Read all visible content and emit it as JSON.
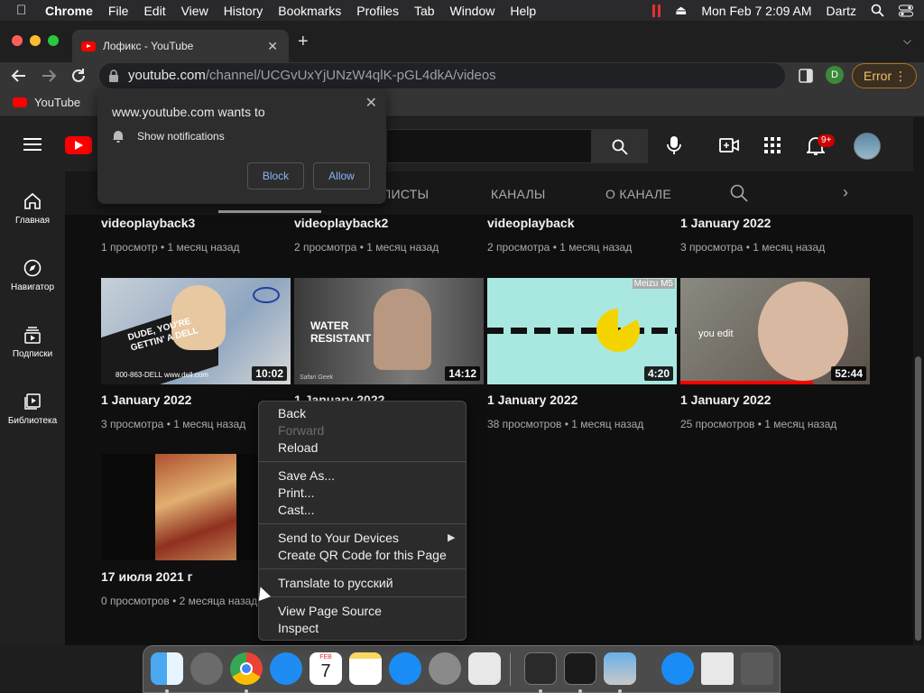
{
  "menubar": {
    "app": "Chrome",
    "items": [
      "File",
      "Edit",
      "View",
      "History",
      "Bookmarks",
      "Profiles",
      "Tab",
      "Window",
      "Help"
    ],
    "datetime": "Mon Feb 7  2:09 AM",
    "user": "Dartz"
  },
  "tab": {
    "title": "Лофикс - YouTube",
    "close": "✕",
    "new_tab": "+"
  },
  "toolbar": {
    "url_host": "youtube.com",
    "url_path": "/channel/UCGvUxYjUNzW4qlK-pGL4dkA/videos",
    "profile_initial": "D",
    "error_label": "Error"
  },
  "bookmarks": {
    "youtube_label": "YouTube"
  },
  "notification_popup": {
    "title": "www.youtube.com wants to",
    "permission": "Show notifications",
    "block_label": "Block",
    "allow_label": "Allow",
    "close": "✕"
  },
  "yt_header": {
    "notif_count": "9+"
  },
  "sidebar": {
    "items": [
      {
        "label": "Главная"
      },
      {
        "label": "Навигатор"
      },
      {
        "label": "Подписки"
      },
      {
        "label": "Библиотека"
      }
    ]
  },
  "channel_tabs": {
    "playlists": "ЛИСТЫ",
    "channels": "КАНАЛЫ",
    "about": "О КАНАЛЕ"
  },
  "videos": {
    "row1": [
      {
        "title": "videoplayback3",
        "meta": "1 просмотр • 1 месяц назад"
      },
      {
        "title": "videoplayback2",
        "meta": "2 просмотра • 1 месяц назад"
      },
      {
        "title": "videoplayback",
        "meta": "2 просмотра • 1 месяц назад"
      },
      {
        "title": "1 January 2022",
        "meta": "3 просмотра • 1 месяц назад"
      }
    ],
    "row2": [
      {
        "title": "1 January 2022",
        "meta": "3 просмотра • 1 месяц назад",
        "duration": "10:02",
        "thumb_text": "DUDE, YOU'RE GETTIN' A DELL",
        "thumb_sub": "800-863-DELL   www.dell.com"
      },
      {
        "title": "1 January 2022",
        "meta": "",
        "duration": "14:12",
        "thumb_text": "WATER RESISTANT",
        "thumb_sub": "Safari Geek"
      },
      {
        "title": "1 January 2022",
        "meta": "38 просмотров • 1 месяц назад",
        "duration": "4:20",
        "thumb_text": "Meizu M5"
      },
      {
        "title": "1 January 2022",
        "meta": "25 просмотров • 1 месяц назад",
        "duration": "52:44",
        "thumb_text": "you edit",
        "progress": 0.7
      }
    ],
    "row3": [
      {
        "title": "17 июля 2021 г",
        "meta": "0 просмотров • 2 месяца назад"
      }
    ]
  },
  "context_menu": {
    "group1": [
      "Back",
      "Forward",
      "Reload"
    ],
    "group2": [
      "Save As...",
      "Print...",
      "Cast..."
    ],
    "group3": [
      "Send to Your Devices",
      "Create QR Code for this Page"
    ],
    "group4": [
      "Translate to русский"
    ],
    "group5": [
      "View Page Source",
      "Inspect"
    ]
  },
  "dock": {
    "calendar_month": "FEB",
    "calendar_day": "7"
  },
  "colors": {
    "yt_red": "#ff0000",
    "chrome_bg": "#353535",
    "page_bg": "#0f0f0f",
    "link_blue": "#8ab4f8"
  }
}
